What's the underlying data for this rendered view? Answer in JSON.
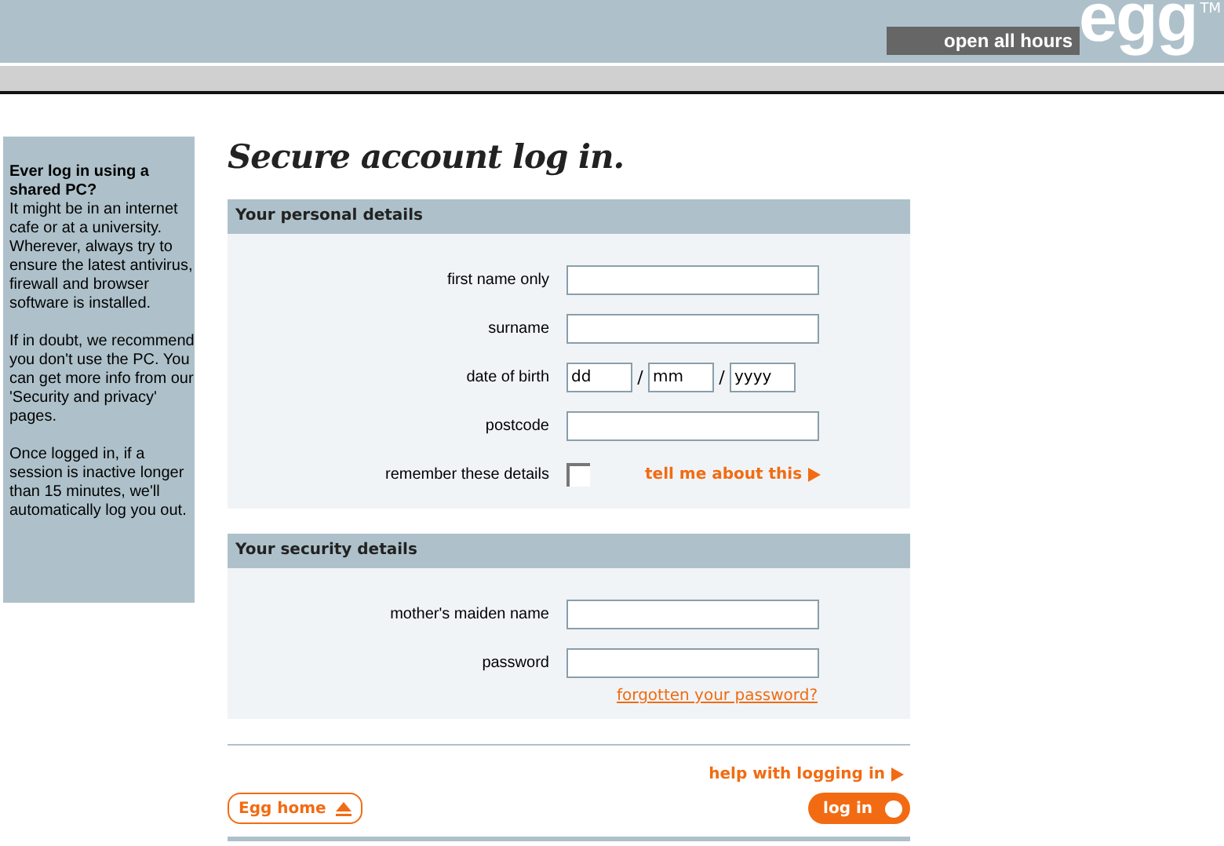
{
  "header": {
    "tagline": "open all hours",
    "logo": "egg",
    "trademark": "TM"
  },
  "sidebar": {
    "title": "Ever log in using a shared PC?",
    "paragraphs": [
      "It might be in an internet cafe or at a university. Wherever, always try to ensure the latest antivirus, firewall and browser software is installed.",
      "If in doubt, we recommend you don't use the PC. You can get more info from our 'Security and privacy' pages.",
      "Once logged in, if a session is inactive longer than 15 minutes, we'll automatically log you out."
    ]
  },
  "title": "Secure account log in.",
  "sections": [
    {
      "heading": "Your personal details",
      "fields": [
        {
          "kind": "text",
          "label": "first name only"
        },
        {
          "kind": "text",
          "label": "surname"
        },
        {
          "kind": "date",
          "label": "date of birth",
          "parts": [
            "dd",
            "mm",
            "yyyy"
          ],
          "separator": "/"
        },
        {
          "kind": "text",
          "label": "postcode"
        },
        {
          "kind": "checkbox",
          "label": "remember these details",
          "checked": false,
          "link": "tell me about this"
        }
      ]
    },
    {
      "heading": "Your security details",
      "fields": [
        {
          "kind": "text",
          "label": "mother's maiden name"
        },
        {
          "kind": "password",
          "label": "password"
        }
      ],
      "link": "forgotten your password?"
    }
  ],
  "help_link": "help with logging in",
  "home_button": "Egg home",
  "login_button": "log in"
}
